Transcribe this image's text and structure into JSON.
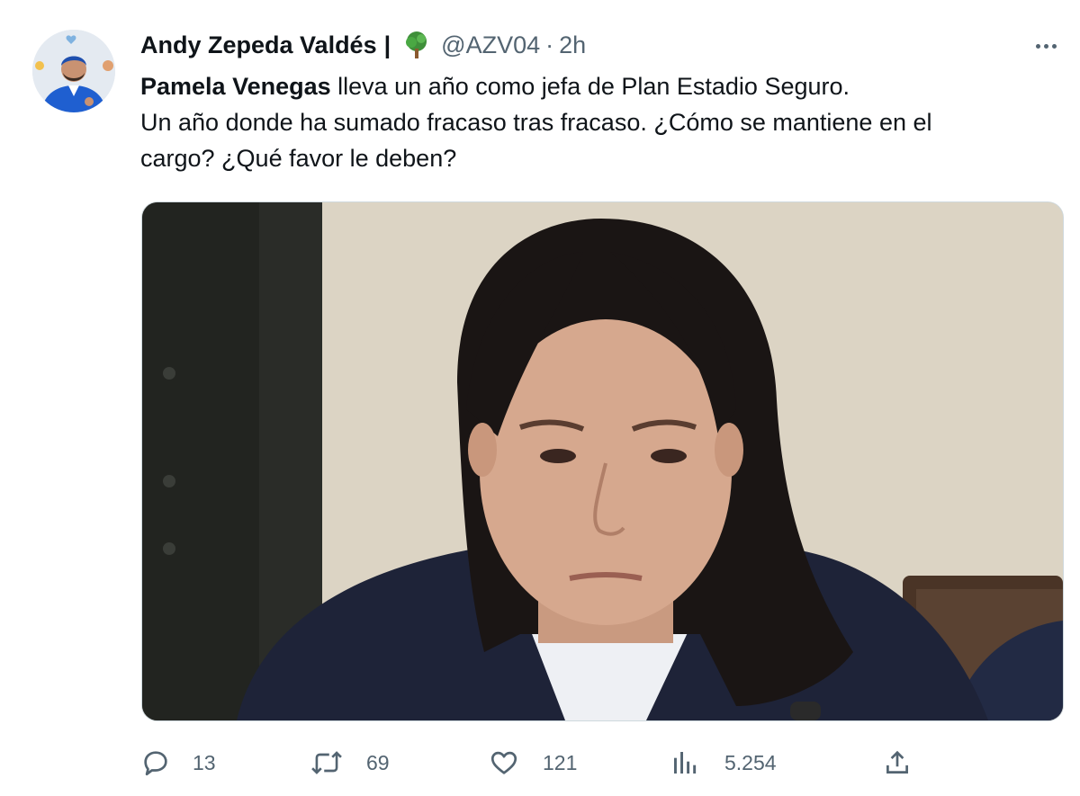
{
  "tweet": {
    "author": {
      "display_name": "Andy Zepeda Valdés",
      "separator": "|",
      "handle": "@AZV04",
      "dot": "·",
      "time": "2h"
    },
    "text": {
      "mention": "Pamela Venegas",
      "line1_rest": " lleva un año como jefa de Plan Estadio Seguro.",
      "line2": "Un año donde ha sumado fracaso tras fracaso. ¿Cómo se mantiene en el",
      "line3": "cargo? ¿Qué favor le deben?"
    },
    "stats": {
      "replies": "13",
      "retweets": "69",
      "likes": "121",
      "views": "5.254"
    },
    "icons": {
      "avatar": "profile-avatar",
      "tree": "tree-emoji-icon",
      "more": "more-icon",
      "reply": "reply-icon",
      "retweet": "retweet-icon",
      "like": "heart-icon",
      "views": "views-icon",
      "share": "share-icon"
    },
    "colors": {
      "text": "#0f1419",
      "secondary": "#536471",
      "border": "#cfd9de"
    }
  }
}
